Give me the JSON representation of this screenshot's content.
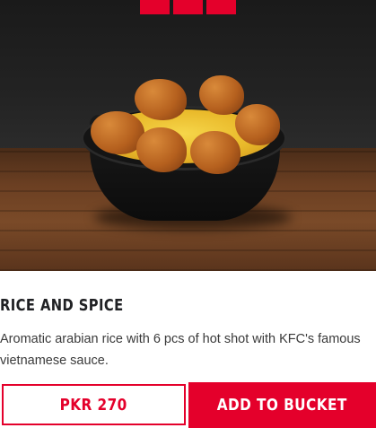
{
  "product": {
    "name": "RICE AND SPICE",
    "description": "Aromatic arabian rice with 6 pcs of hot shot with KFC's famous vietnamese sauce.",
    "image": "rice-and-spice-bowl-photo"
  },
  "actions": {
    "price_label": "PKR 270",
    "add_to_bucket_label": "ADD TO BUCKET"
  },
  "colors": {
    "brand_red": "#e4002b",
    "text_dark": "#202124",
    "text_body": "#3a3a3a"
  }
}
